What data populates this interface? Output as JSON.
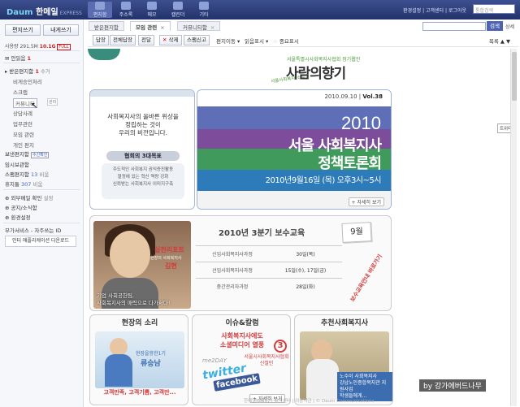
{
  "topbar": {
    "logo": "한메일",
    "logo_brand": "Daum",
    "logo_badge": "EXPRESS",
    "icons": [
      {
        "label": "편지함",
        "icon": "mailbox-icon",
        "active": true
      },
      {
        "label": "주소록",
        "icon": "address-book-icon",
        "active": false
      },
      {
        "label": "메모",
        "icon": "memo-icon",
        "active": false
      },
      {
        "label": "캘린더",
        "icon": "calendar-icon",
        "active": false
      },
      {
        "label": "기타",
        "icon": "etc-icon",
        "active": false
      }
    ],
    "right_links": "환경설정 | 고객센터 | 로그아웃",
    "search_placeholder": "통합검색"
  },
  "sidebar": {
    "write_button": "편지쓰기",
    "to_me_button": "내게쓰기",
    "usage_label": "사용량",
    "usage_used": "291.5M",
    "usage_total": "10.1G",
    "usage_badge": "FULL",
    "items": [
      {
        "label": "안읽음",
        "count": "1",
        "type": "main"
      },
      {
        "label": "받은편지함",
        "count": "1",
        "type": "main",
        "extra": "수거"
      },
      {
        "label": "비게승인처리",
        "type": "sub"
      },
      {
        "label": "스크랩",
        "type": "sub"
      },
      {
        "label": "커뮤니티",
        "type": "sub",
        "active": true
      },
      {
        "label": "상담사례",
        "type": "sub"
      },
      {
        "label": "업무관련",
        "type": "sub"
      },
      {
        "label": "모임 관련",
        "type": "sub"
      },
      {
        "label": "개인 편지",
        "type": "sub"
      },
      {
        "label": "보낸편지함",
        "type": "main",
        "extra": "수신확인"
      },
      {
        "label": "임시보관함",
        "type": "main"
      },
      {
        "label": "스팸편지함",
        "count": "13",
        "type": "main",
        "extra": "비움"
      },
      {
        "label": "휴지통",
        "count": "307",
        "type": "main",
        "extra": "비움"
      },
      {
        "label": "외부메일 확인",
        "type": "main",
        "extra": "설정"
      },
      {
        "label": "공지/소식함",
        "type": "main"
      },
      {
        "label": "환경설정",
        "type": "main"
      },
      {
        "label": "부가서비스 - 자주쓰는 ID",
        "type": "plain"
      }
    ],
    "manage_label": "관리",
    "banner": "인터 애플리케이션 다운로드"
  },
  "tabs": [
    {
      "label": "받은편지함",
      "active": false
    },
    {
      "label": "모임 관련",
      "active": true
    },
    {
      "label": "커뮤니티함",
      "active": false
    }
  ],
  "main_search": {
    "button": "검색",
    "more": "상세"
  },
  "toolbar": {
    "buttons": [
      "답장",
      "전체답장",
      "전달",
      "삭제",
      "스팸신고"
    ],
    "links": [
      "편지이동",
      "읽음표시",
      "중요표시"
    ],
    "right": "목록"
  },
  "newsletter": {
    "subtitle": "서울특별시사회복지사협회 정기웹진",
    "brand": "사람의향기",
    "brand_small": "서울사회복지 소식",
    "intro_text": [
      "사회복지사의 올바른 위상을",
      "정립하는 것이",
      "우리의 비전입니다."
    ],
    "intro_label": "협회의 3대목표",
    "intro_points": [
      "주도적인 사회복지 권익증진활동",
      "열정에 있는 혁신 역량 강화",
      "신뢰받는 사회복지사 이미지구축"
    ],
    "issue_date": "2010.09.10",
    "issue_vol": "Vol.38",
    "forum_year": "2010",
    "forum_title1": "서울 사회복지사",
    "forum_title2": "정책토론회",
    "forum_when": "2010년9월16일 (목) 오후3시~5시",
    "more": "자세히 보기",
    "edu": {
      "tag": "실천리포트",
      "tag_sub": "현장의 사회복지사",
      "name": "김현",
      "caption": [
        "기업 사회공헌팀,",
        "사회복지사의 매력으로 다가서다!"
      ],
      "title": "2010년 3분기 보수교육",
      "month": "9월",
      "rows": [
        {
          "course": "신입사회복지사과정",
          "date": "30일(목)"
        },
        {
          "course": "선임사회복지사과정",
          "date": "15일(수), 17일(금)"
        },
        {
          "course": "중간관리자과정",
          "date": "28일(화)"
        }
      ],
      "apply": "보수교육안내 바로가기"
    },
    "cards": [
      {
        "title": "현장의 소리",
        "sub": "현장을향한1기",
        "name": "류승남",
        "caption": "고객만족, 고객기쁨, 고객만..."
      },
      {
        "title": "이슈&칼럼",
        "lead1": "사회복지사에도",
        "lead2": "소셜미디어 열풍",
        "num": "3",
        "me2day": "me2DAY",
        "twitter": "twitter",
        "facebook": "facebook",
        "guest": "서울시사회복지사협회 신철민",
        "more": "자세히 보기"
      },
      {
        "title": "추천사회복지사",
        "caption_lines": [
          "노수이 사회복지사",
          "강남노인종합복지관 지원사업",
          "학생들에게..."
        ]
      }
    ]
  },
  "side_badge": "트위터",
  "watermark": "by 강가에버드나무",
  "footer": "한메일Ready | 고객센터 | 이용약관 | © Daum Communications"
}
